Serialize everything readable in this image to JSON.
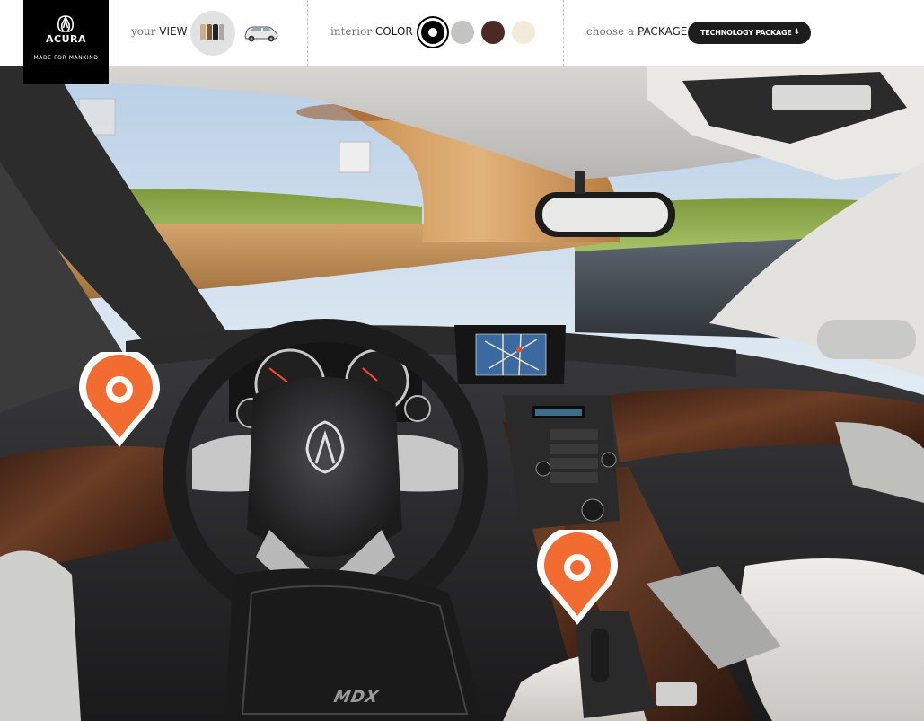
{
  "brand": {
    "name": "ACURA",
    "tagline": "MADE FOR MANKIND"
  },
  "view": {
    "prefix": "your",
    "label": "VIEW",
    "options": [
      {
        "name": "interior",
        "icon": "seats-icon",
        "selected": true
      },
      {
        "name": "exterior",
        "icon": "suv-icon",
        "selected": false
      }
    ]
  },
  "color": {
    "prefix": "interior",
    "label": "COLOR",
    "swatches": [
      {
        "name": "ebony",
        "hex": "#000000",
        "selected": true
      },
      {
        "name": "graystone",
        "hex": "#c4c4c2",
        "selected": false
      },
      {
        "name": "umber",
        "hex": "#4a2a22",
        "selected": false
      },
      {
        "name": "parchment",
        "hex": "#f2ebdb",
        "selected": false
      }
    ]
  },
  "package": {
    "prefix": "choose a",
    "label": "PACKAGE",
    "selected": "TECHNOLOGY PACKAGE",
    "icon": "double-chevron-down-icon"
  },
  "scene": {
    "badge": "MDX"
  },
  "hotspots": [
    {
      "name": "dashboard-hotspot",
      "icon": "location-pin-icon",
      "color": "#f26b30"
    },
    {
      "name": "shifter-hotspot",
      "icon": "location-pin-icon",
      "color": "#f26b30"
    }
  ]
}
